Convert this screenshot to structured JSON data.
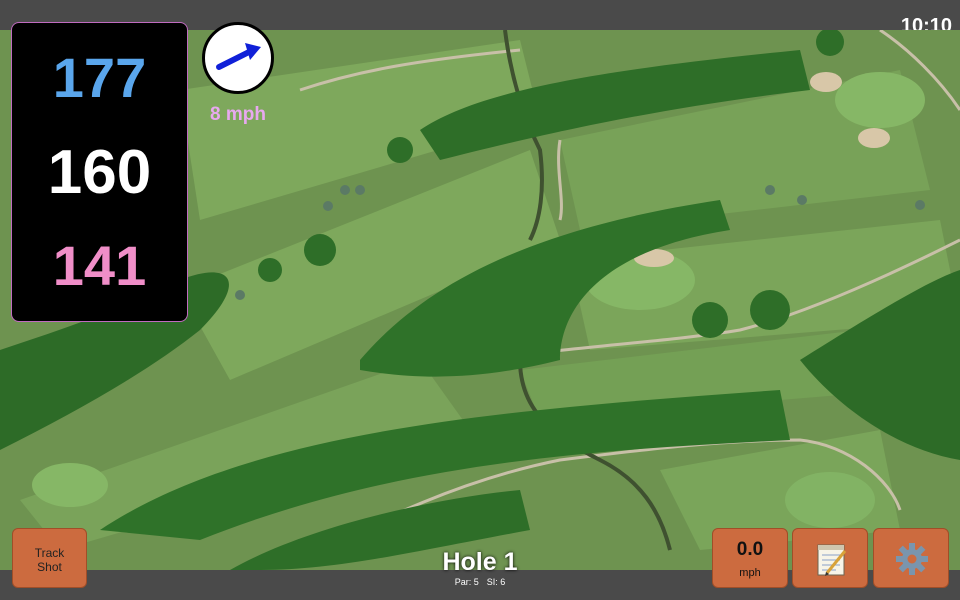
{
  "clock": "10:10",
  "distances": {
    "back": "177",
    "middle": "160",
    "front": "141"
  },
  "wind": {
    "speed_text": "8 mph",
    "direction_icon": "arrow-right-up-icon"
  },
  "hole": {
    "title": "Hole 1",
    "par": "Par: 5",
    "si": "SI: 6"
  },
  "buttons": {
    "track_line1": "Track",
    "track_line2": "Shot",
    "speed_value": "0.0",
    "speed_unit": "mph",
    "notes_icon": "notepad-icon",
    "settings_icon": "gear-icon"
  },
  "colors": {
    "back": "#5aa6ec",
    "middle": "#ffffff",
    "front": "#f08ec8",
    "button": "#cc6b3f",
    "wind_arrow": "#1020d8"
  }
}
